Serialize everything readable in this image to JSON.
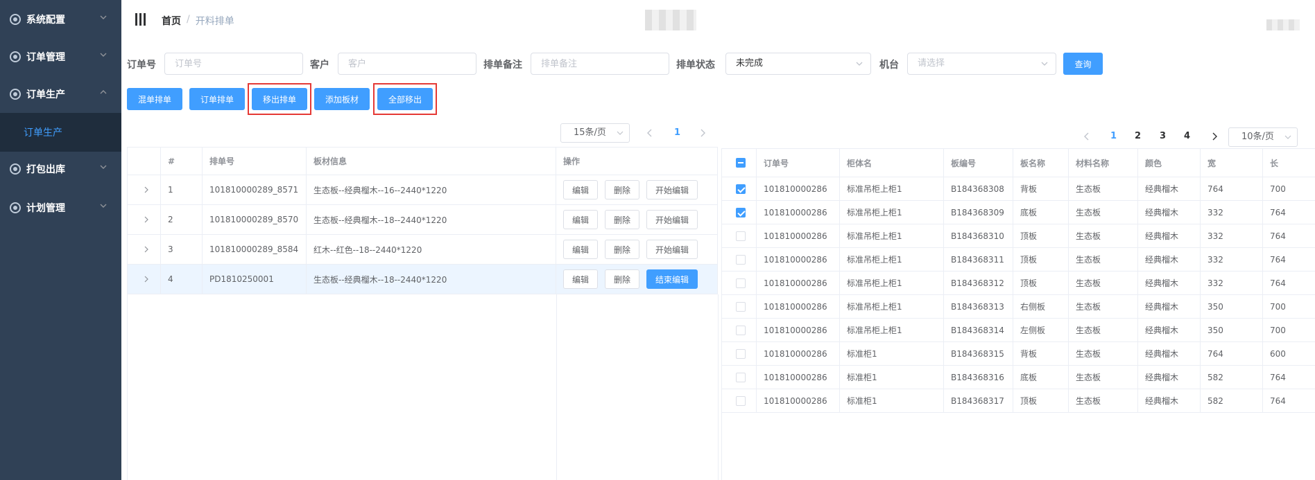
{
  "sidebar": {
    "items": [
      {
        "label": "系统配置"
      },
      {
        "label": "订单管理"
      },
      {
        "label": "订单生产"
      },
      {
        "label": "打包出库"
      },
      {
        "label": "计划管理"
      }
    ],
    "sub_item": "订单生产"
  },
  "breadcrumb": {
    "home": "首页",
    "separator": "/",
    "current": "开料排单"
  },
  "filters": {
    "order_no_label": "订单号",
    "order_no_placeholder": "订单号",
    "customer_label": "客户",
    "customer_placeholder": "客户",
    "remark_label": "排单备注",
    "remark_placeholder": "排单备注",
    "status_label": "排单状态",
    "status_value": "未完成",
    "machine_label": "机台",
    "machine_placeholder": "请选择",
    "query_button": "查询"
  },
  "toolbar": {
    "mixed_schedule": "混单排单",
    "order_schedule": "订单排单",
    "remove_schedule": "移出排单",
    "add_board": "添加板材",
    "remove_all": "全部移出"
  },
  "left_pager": {
    "page_size": "15条/页",
    "current_page": "1"
  },
  "left_table": {
    "columns": [
      "#",
      "排单号",
      "板材信息",
      "操作"
    ],
    "rows": [
      {
        "idx": "1",
        "no": "101810000289_8571",
        "info": "生态板--经典榴木--16--2440*1220",
        "edit": "编辑",
        "delete": "删除",
        "toggle": "开始编辑"
      },
      {
        "idx": "2",
        "no": "101810000289_8570",
        "info": "生态板--经典榴木--18--2440*1220",
        "edit": "编辑",
        "delete": "删除",
        "toggle": "开始编辑"
      },
      {
        "idx": "3",
        "no": "101810000289_8584",
        "info": "红木--红色--18--2440*1220",
        "edit": "编辑",
        "delete": "删除",
        "toggle": "开始编辑"
      },
      {
        "idx": "4",
        "no": "PD1810250001",
        "info": "生态板--经典榴木--18--2440*1220",
        "edit": "编辑",
        "delete": "删除",
        "toggle": "结束编辑"
      }
    ]
  },
  "right_pager": {
    "pages": [
      "1",
      "2",
      "3",
      "4"
    ],
    "current_page": "1",
    "page_size": "10条/页"
  },
  "right_table": {
    "columns": [
      "订单号",
      "柜体名",
      "板编号",
      "板名称",
      "材料名称",
      "颜色",
      "宽",
      "长"
    ],
    "rows": [
      {
        "checked": true,
        "cells": [
          "101810000286",
          "标准吊柜上柜1",
          "B184368308",
          "背板",
          "生态板",
          "经典榴木",
          "764",
          "700"
        ]
      },
      {
        "checked": true,
        "cells": [
          "101810000286",
          "标准吊柜上柜1",
          "B184368309",
          "底板",
          "生态板",
          "经典榴木",
          "332",
          "764"
        ]
      },
      {
        "checked": false,
        "cells": [
          "101810000286",
          "标准吊柜上柜1",
          "B184368310",
          "顶板",
          "生态板",
          "经典榴木",
          "332",
          "764"
        ]
      },
      {
        "checked": false,
        "cells": [
          "101810000286",
          "标准吊柜上柜1",
          "B184368311",
          "顶板",
          "生态板",
          "经典榴木",
          "332",
          "764"
        ]
      },
      {
        "checked": false,
        "cells": [
          "101810000286",
          "标准吊柜上柜1",
          "B184368312",
          "顶板",
          "生态板",
          "经典榴木",
          "332",
          "764"
        ]
      },
      {
        "checked": false,
        "cells": [
          "101810000286",
          "标准吊柜上柜1",
          "B184368313",
          "右侧板",
          "生态板",
          "经典榴木",
          "350",
          "700"
        ]
      },
      {
        "checked": false,
        "cells": [
          "101810000286",
          "标准吊柜上柜1",
          "B184368314",
          "左侧板",
          "生态板",
          "经典榴木",
          "350",
          "700"
        ]
      },
      {
        "checked": false,
        "cells": [
          "101810000286",
          "标准柜1",
          "B184368315",
          "背板",
          "生态板",
          "经典榴木",
          "764",
          "600"
        ]
      },
      {
        "checked": false,
        "cells": [
          "101810000286",
          "标准柜1",
          "B184368316",
          "底板",
          "生态板",
          "经典榴木",
          "582",
          "764"
        ]
      },
      {
        "checked": false,
        "cells": [
          "101810000286",
          "标准柜1",
          "B184368317",
          "顶板",
          "生态板",
          "经典榴木",
          "582",
          "764"
        ]
      }
    ]
  },
  "colors": {
    "primary": "#409eff",
    "sidebar": "#304156",
    "highlight": "#e53935"
  }
}
